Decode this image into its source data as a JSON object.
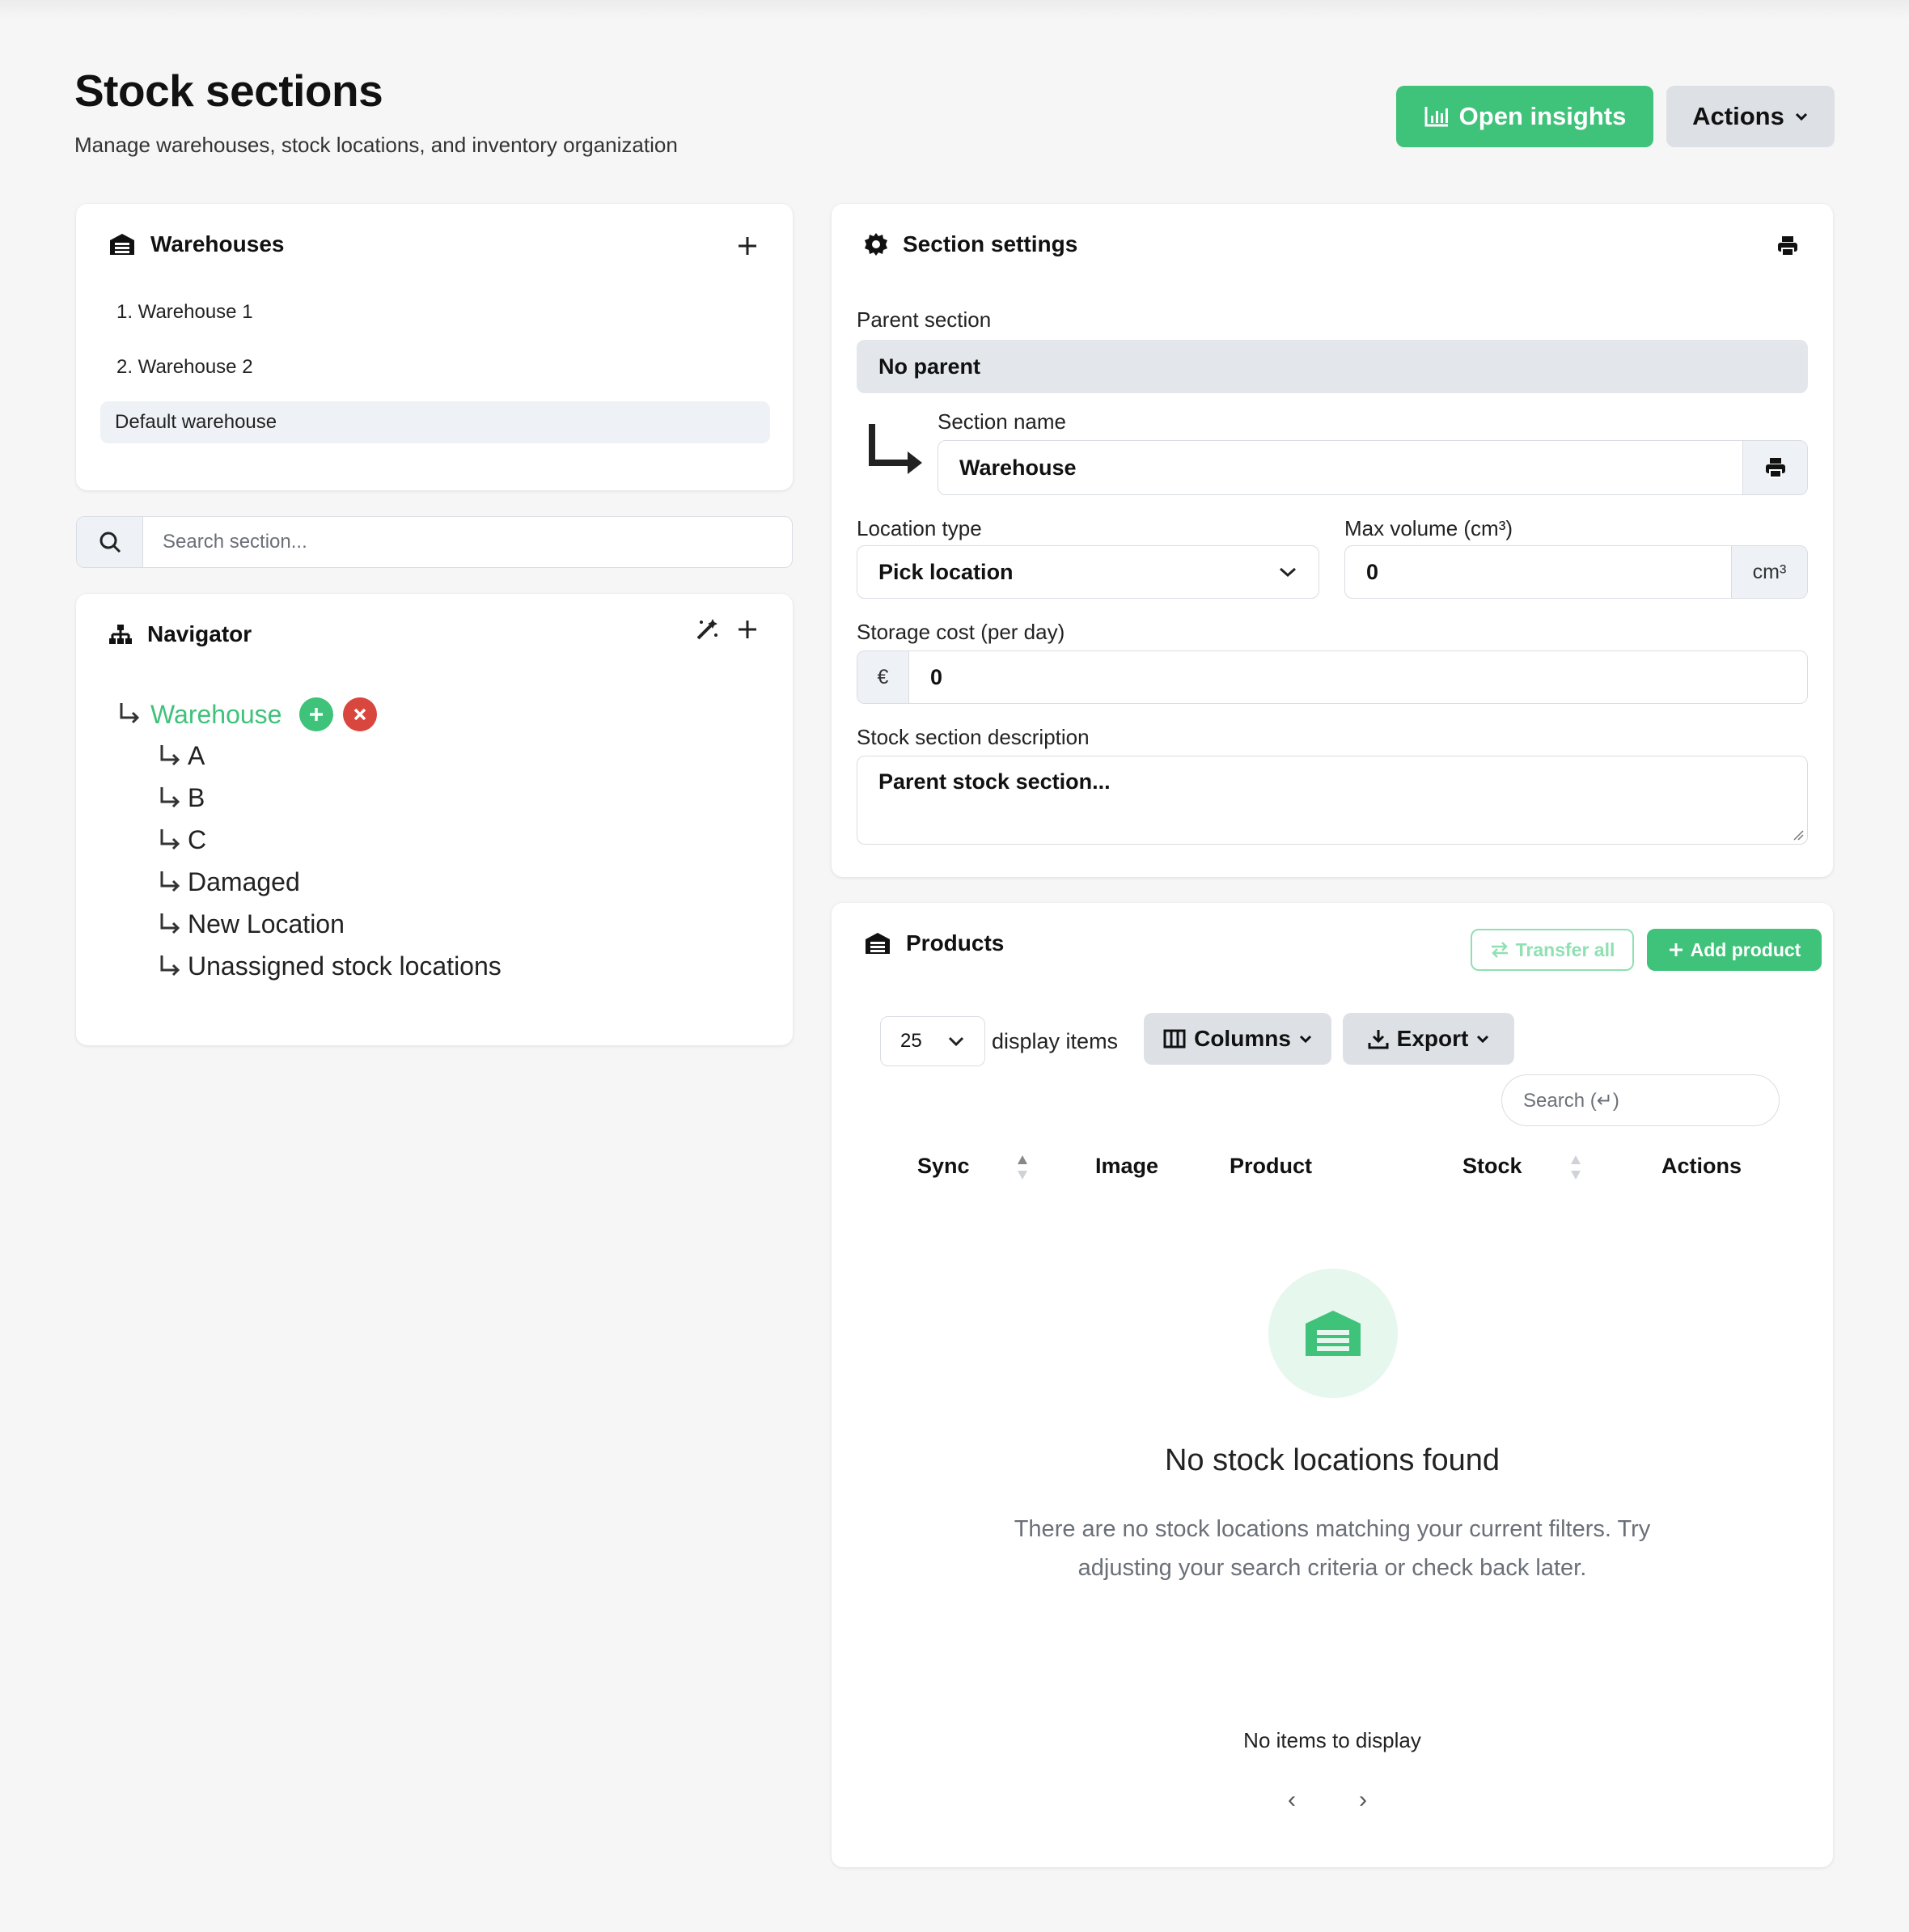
{
  "header": {
    "title": "Stock sections",
    "subtitle": "Manage warehouses, stock locations, and inventory organization",
    "insights_label": "Open insights",
    "actions_label": "Actions"
  },
  "warehouses": {
    "title": "Warehouses",
    "items": [
      "1. Warehouse 1",
      "2. Warehouse 2"
    ],
    "default_label": "Default warehouse"
  },
  "search": {
    "placeholder": "Search section..."
  },
  "navigator": {
    "title": "Navigator",
    "root": "Warehouse",
    "children": [
      "A",
      "B",
      "C",
      "Damaged",
      "New Location",
      "Unassigned stock locations"
    ]
  },
  "settings": {
    "title": "Section settings",
    "parent_label": "Parent section",
    "parent_value": "No parent",
    "name_label": "Section name",
    "name_value": "Warehouse",
    "location_type_label": "Location type",
    "location_type_value": "Pick location",
    "max_volume_label": "Max volume (cm³)",
    "max_volume_value": "0",
    "max_volume_unit": "cm³",
    "storage_cost_label": "Storage cost (per day)",
    "currency": "€",
    "storage_cost_value": "0",
    "description_label": "Stock section description",
    "description_placeholder": "Parent stock section..."
  },
  "products": {
    "title": "Products",
    "transfer_label": "Transfer all",
    "add_label": "Add product",
    "page_size": "25",
    "display_items_label": "display items",
    "columns_label": "Columns",
    "export_label": "Export",
    "search_placeholder": "Search (↵)",
    "columns": [
      "Sync",
      "Image",
      "Product",
      "Stock",
      "Actions"
    ],
    "empty_title": "No stock locations found",
    "empty_line1": "There are no stock locations matching your current filters. Try",
    "empty_line2": "adjusting your search criteria or check back later.",
    "no_items": "No items to display",
    "prev": "‹",
    "next": "›"
  },
  "colors": {
    "accent": "#3fc27a",
    "danger": "#d9463e",
    "muted_bg": "#eef1f5"
  }
}
